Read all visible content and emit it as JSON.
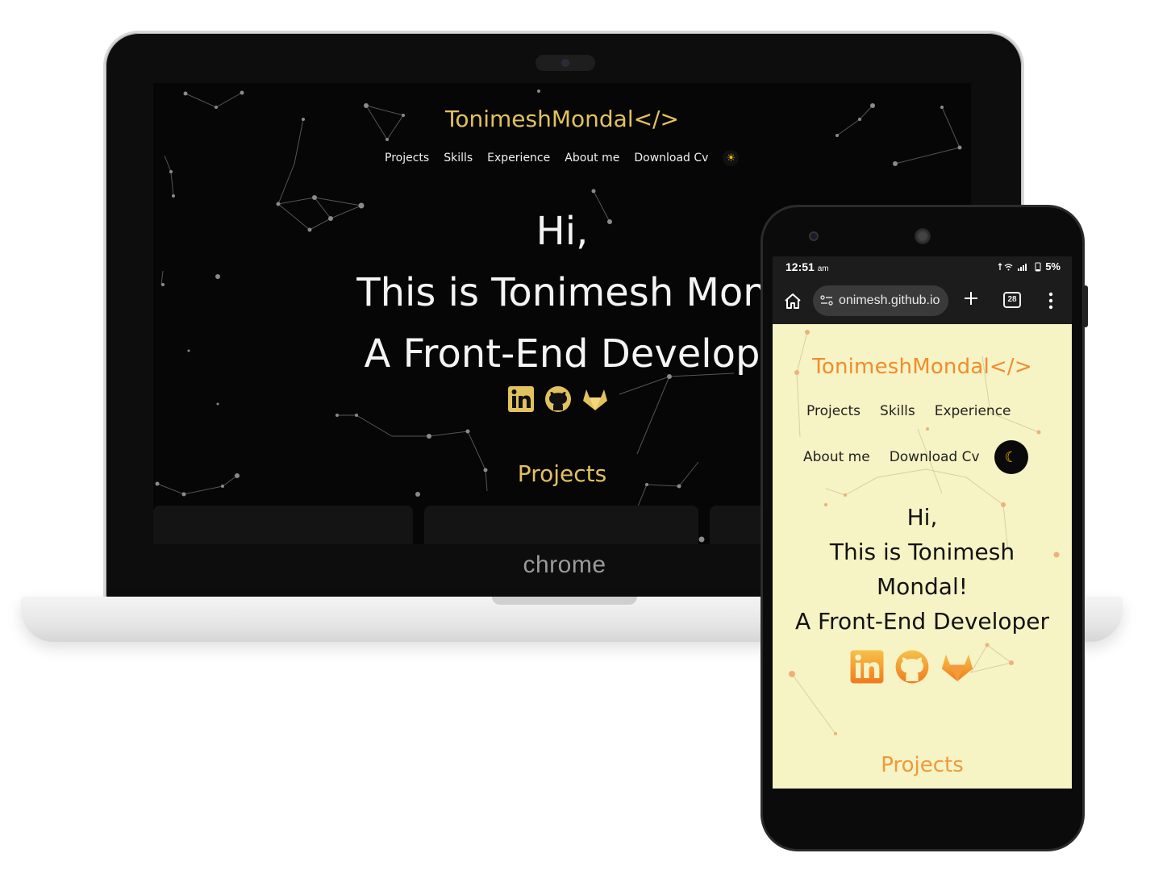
{
  "laptop": {
    "brand": "chrome",
    "site": {
      "logo": "TonimeshMondal</>",
      "nav": [
        "Projects",
        "Skills",
        "Experience",
        "About me",
        "Download Cv"
      ],
      "theme_toggle_icon": "sun-icon",
      "hero_lines": [
        "Hi,",
        "This is Tonimesh Mon",
        "A Front-End Develop"
      ],
      "social_icons": [
        "linkedin-icon",
        "github-icon",
        "gitlab-icon"
      ],
      "section_title": "Projects",
      "colors": {
        "background": "#060606",
        "accent": "#e2c25e",
        "text": "#f4f4f4"
      }
    }
  },
  "phone": {
    "status": {
      "time": "12:51",
      "ampm": "am",
      "battery": "5%"
    },
    "browser": {
      "url": "onimesh.github.io",
      "tab_count": "28"
    },
    "site": {
      "logo": "TonimeshMondal</>",
      "nav_row1": [
        "Projects",
        "Skills",
        "Experience"
      ],
      "nav_row2": [
        "About me",
        "Download Cv"
      ],
      "theme_toggle_icon": "moon-icon",
      "hero_lines": [
        "Hi,",
        "This is Tonimesh",
        "Mondal!",
        "A Front-End Developer"
      ],
      "social_icons": [
        "linkedin-icon",
        "github-icon",
        "gitlab-icon"
      ],
      "section_title": "Projects",
      "colors": {
        "background": "#f6f3c4",
        "accent": "#ef8d2f",
        "text": "#121212"
      }
    }
  }
}
